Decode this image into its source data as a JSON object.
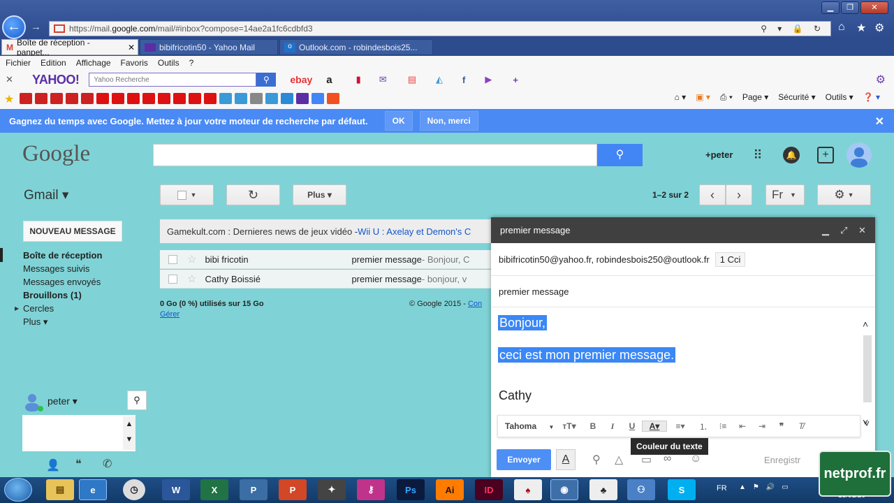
{
  "browser": {
    "url_prefix": "https://mail.",
    "url_domain": "google.com",
    "url_suffix": "/mail/#inbox?compose=14ae2a1fc6cdbfd3",
    "tabs": [
      {
        "label": "Boîte de réception - panpet..."
      },
      {
        "label": "bibifricotin50 - Yahoo Mail"
      },
      {
        "label": "Outlook.com - robindesbois25..."
      }
    ],
    "menu": [
      "Fichier",
      "Edition",
      "Affichage",
      "Favoris",
      "Outils",
      "?"
    ],
    "yahoo_logo": "YAHOO!",
    "yahoo_placeholder": "Yahoo Recherche",
    "ebay": "ebay",
    "ie_tools": [
      "Page ▾",
      "Sécurité ▾",
      "Outils ▾"
    ]
  },
  "banner": {
    "text": "Gagnez du temps avec Google. Mettez à jour votre moteur de recherche par défaut.",
    "ok": "OK",
    "no": "Non, merci",
    "close": "✕"
  },
  "header": {
    "logo": "Google",
    "user": "+peter",
    "app": "Gmail ▾"
  },
  "toolbar": {
    "more": "Plus ▾",
    "pagination": "1–2 sur 2",
    "lang": "Fr"
  },
  "sidebar": {
    "new_message": "NOUVEAU MESSAGE",
    "items": [
      {
        "label": "Boîte de réception"
      },
      {
        "label": "Messages suivis"
      },
      {
        "label": "Messages envoyés"
      },
      {
        "label": "Brouillons (1)"
      },
      {
        "label": "Cercles"
      },
      {
        "label": "Plus ▾"
      }
    ],
    "chat_user": "peter ▾"
  },
  "promo": {
    "text": "Gamekult.com : Dernieres news de jeux vidéo - ",
    "link": "Wii U : Axelay et Demon's C"
  },
  "messages": [
    {
      "sender": "bibi fricotin",
      "subject": "premier message",
      "snippet": " - Bonjour, C"
    },
    {
      "sender": "Cathy Boissié",
      "subject": "premier message",
      "snippet": " - bonjour, v"
    }
  ],
  "footer": {
    "storage": "0 Go (0 %) utilisés sur 15 Go",
    "manage": "Gérer",
    "copyright": "© Google 2015 - ",
    "link": "Con"
  },
  "compose": {
    "title": "premier message",
    "recipients": "bibifricotin50@yahoo.fr, robindesbois250@outlook.fr",
    "cci": "1 Cci",
    "subject": "premier message",
    "body_line1": "Bonjour,",
    "body_line2": "ceci est mon premier message.",
    "signature": "Cathy",
    "font": "Tahoma",
    "tooltip": "Couleur du texte",
    "send": "Envoyer",
    "saved": "Enregistr"
  },
  "taskbar": {
    "lang": "FR",
    "date": "13/01/20"
  },
  "watermark": "netprof.fr",
  "colors": {
    "gmail_bg": "#7fd3d6",
    "banner": "#4a8af4",
    "selection": "#3a87f6",
    "send": "#4d8ff5"
  }
}
